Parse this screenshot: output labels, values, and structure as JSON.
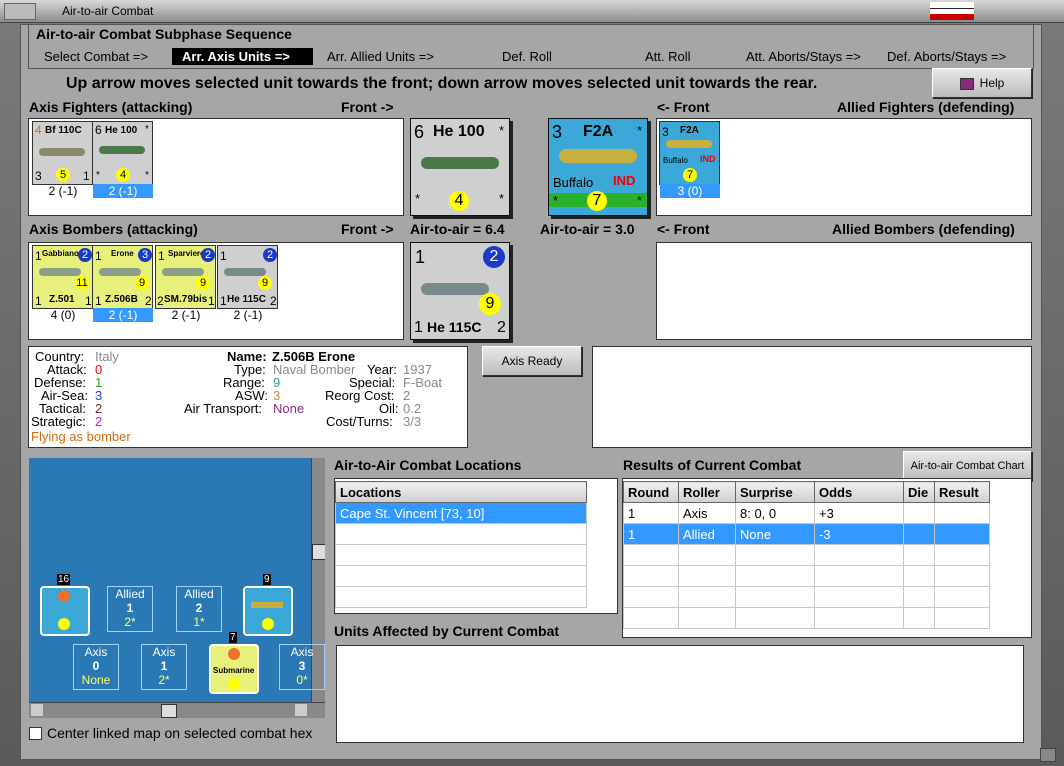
{
  "window": {
    "title": "Air-to-air Combat"
  },
  "phase": {
    "title": "Air-to-air Combat Subphase Sequence",
    "steps": [
      "Select Combat =>",
      "Arr. Axis Units =>",
      "Arr. Allied Units =>",
      "Def. Roll",
      "Att. Roll",
      "Att. Aborts/Stays =>",
      "Def. Aborts/Stays =>"
    ]
  },
  "instruction": "Up arrow moves selected unit towards the front; down arrow moves selected unit towards the rear.",
  "help_label": "Help",
  "labels": {
    "axis_fighters": "Axis Fighters (attacking)",
    "front_right": "Front ->",
    "front_left": "<- Front",
    "allied_fighters": "Allied Fighters (defending)",
    "axis_bombers": "Axis Bombers (attacking)",
    "allied_bombers": "Allied Bombers (defending)",
    "axis_a2a": "Air-to-air = 6.4",
    "allied_a2a": "Air-to-air = 3.0"
  },
  "axis_fighters": [
    {
      "tl": "4",
      "name": "Bf 110C",
      "tr": "1",
      "bl": "3",
      "val": "5",
      "br": "1",
      "cap": "2 (-1)",
      "sel": false,
      "bg": "#cfcfcf"
    },
    {
      "tl": "6",
      "name": "He 100",
      "tr": "*",
      "bl": "*",
      "val": "4",
      "br": "*",
      "cap": "2 (-1)",
      "sel": true,
      "bg": "#cfcfcf"
    }
  ],
  "axis_lead_fighter": {
    "tl": "6",
    "name": "He 100",
    "val": "4",
    "bl": "*",
    "br": "*",
    "tr": "*"
  },
  "allied_lead_fighter": {
    "tl": "3",
    "name": "F2A",
    "sub": "Buffalo",
    "nat": "IND",
    "val": "7",
    "bl": "*",
    "br": "*",
    "tr": "*"
  },
  "allied_fighters": [
    {
      "tl": "3",
      "name": "F2A",
      "sub": "Buffalo",
      "nat": "IND",
      "val": "7",
      "cap": "3 (0)",
      "sel": true
    }
  ],
  "axis_bombers": [
    {
      "tl": "1",
      "name": "Gabbiano",
      "tr": "2",
      "bl": "1",
      "code": "Z.501",
      "br": "1",
      "val": "11",
      "cap": "4 (0)",
      "sel": false,
      "bg": "#e6f07a"
    },
    {
      "tl": "1",
      "name": "Erone",
      "tr": "3",
      "bl": "1",
      "code": "Z.506B",
      "br": "2",
      "val": "9",
      "cap": "2 (-1)",
      "sel": true,
      "bg": "#e6f07a"
    },
    {
      "tl": "1",
      "name": "Sparviero",
      "tr": "2",
      "bl": "2",
      "code": "SM.79bis",
      "br": "1",
      "val": "9",
      "cap": "2 (-1)",
      "sel": false,
      "bg": "#e6f07a"
    },
    {
      "tl": "1",
      "name": "",
      "tr": "2",
      "bl": "1",
      "code": "He 115C",
      "br": "2",
      "val": "9",
      "cap": "2 (-1)",
      "sel": false,
      "bg": "#cfcfcf"
    }
  ],
  "axis_lead_bomber": {
    "tl": "1",
    "tr": "2",
    "val": "9",
    "bl": "1",
    "code": "He 115C",
    "br": "2"
  },
  "axis_ready_label": "Axis Ready",
  "unit_info": {
    "country_k": "Country:",
    "country_v": "Italy",
    "attack_k": "Attack:",
    "attack_v": "0",
    "defense_k": "Defense:",
    "defense_v": "1",
    "airsea_k": "Air-Sea:",
    "airsea_v": "3",
    "tactical_k": "Tactical:",
    "tactical_v": "2",
    "strategic_k": "Strategic:",
    "strategic_v": "2",
    "flying": "Flying as bomber",
    "name_k": "Name:",
    "name_v": "Z.506B Erone",
    "type_k": "Type:",
    "type_v": "Naval Bomber",
    "year_k": "Year:",
    "year_v": "1937",
    "range_k": "Range:",
    "range_v": "9",
    "special_k": "Special:",
    "special_v": "F-Boat",
    "asw_k": "ASW:",
    "asw_v": "3",
    "reorg_k": "Reorg Cost:",
    "reorg_v": "2",
    "airt_k": "Air Transport:",
    "airt_v": "None",
    "oil_k": "Oil:",
    "oil_v": "0.2",
    "cost_k": "Cost/Turns:",
    "cost_v": "3/3"
  },
  "locations": {
    "title": "Air-to-Air Combat Locations",
    "header": "Locations",
    "rows": [
      "Cape St. Vincent [73, 10]"
    ]
  },
  "results": {
    "title": "Results of Current Combat",
    "chart_button": "Air-to-air Combat Chart",
    "headers": [
      "Round",
      "Roller",
      "Surprise",
      "Odds",
      "Die",
      "Result"
    ],
    "rows": [
      [
        "1",
        "Axis",
        "8: 0, 0",
        "+3",
        "",
        ""
      ],
      [
        "1",
        "Allied",
        "None",
        "-3",
        "",
        ""
      ]
    ]
  },
  "affected_title": "Units Affected by Current Combat",
  "map": {
    "allied1": {
      "t": "Allied",
      "n": "1",
      "y": "2*"
    },
    "allied2": {
      "t": "Allied",
      "n": "2",
      "y": "1*"
    },
    "axis0": {
      "t": "Axis",
      "n": "0",
      "y": "None"
    },
    "axis1": {
      "t": "Axis",
      "n": "1",
      "y": "2*"
    },
    "axis3": {
      "t": "Axis",
      "n": "3",
      "y": "0*"
    },
    "stack16": "16",
    "stack9": "9",
    "stack7": "7",
    "sub_label": "Submarine",
    "center_label": "Center linked map on selected combat hex"
  },
  "colors": {
    "selection": "#3399ff",
    "axis_counter": "#cfcfcf",
    "italy_counter": "#e6f07a",
    "allied_counter": "#3ba8d8",
    "sea": "#2a78b4"
  }
}
